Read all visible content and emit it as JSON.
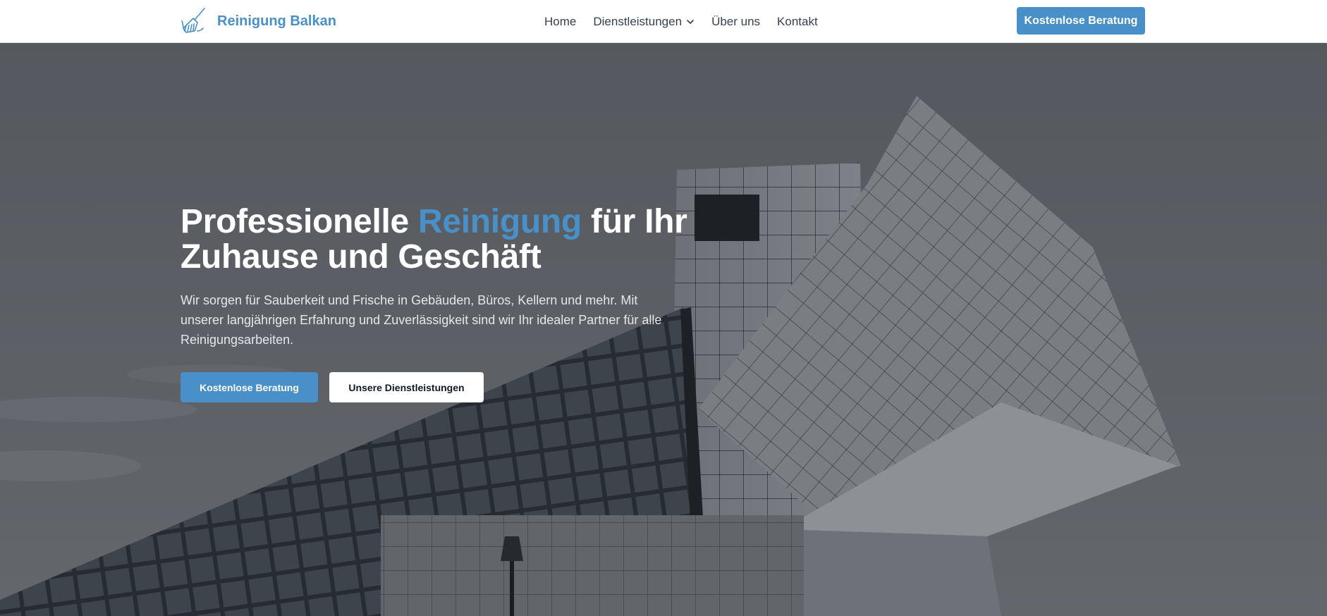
{
  "header": {
    "brand": "Reinigung Balkan",
    "nav": [
      {
        "label": "Home"
      },
      {
        "label": "Dienstleistungen"
      },
      {
        "label": "Über uns"
      },
      {
        "label": "Kontakt"
      }
    ],
    "cta": "Kostenlose Beratung"
  },
  "hero": {
    "title_part1": "Professionelle ",
    "title_accent": "Reinigung",
    "title_part2": " für Ihr Zuhause und Geschäft",
    "text": "Wir sorgen für Sauberkeit und Frische in Gebäuden, Büros, Kellern und mehr. Mit unserer langjährigen Erfahrung und Zuverlässigkeit sind wir Ihr idealer Partner für alle Reinigungsarbeiten.",
    "primary_button": "Kostenlose Beratung",
    "secondary_button": "Unsere Dienstleistungen"
  },
  "icons": {
    "brand": "broom-icon",
    "dropdown": "chevron-down-icon"
  },
  "colors": {
    "accent": "#4a90c8",
    "text_dark": "#374151",
    "white": "#ffffff"
  }
}
